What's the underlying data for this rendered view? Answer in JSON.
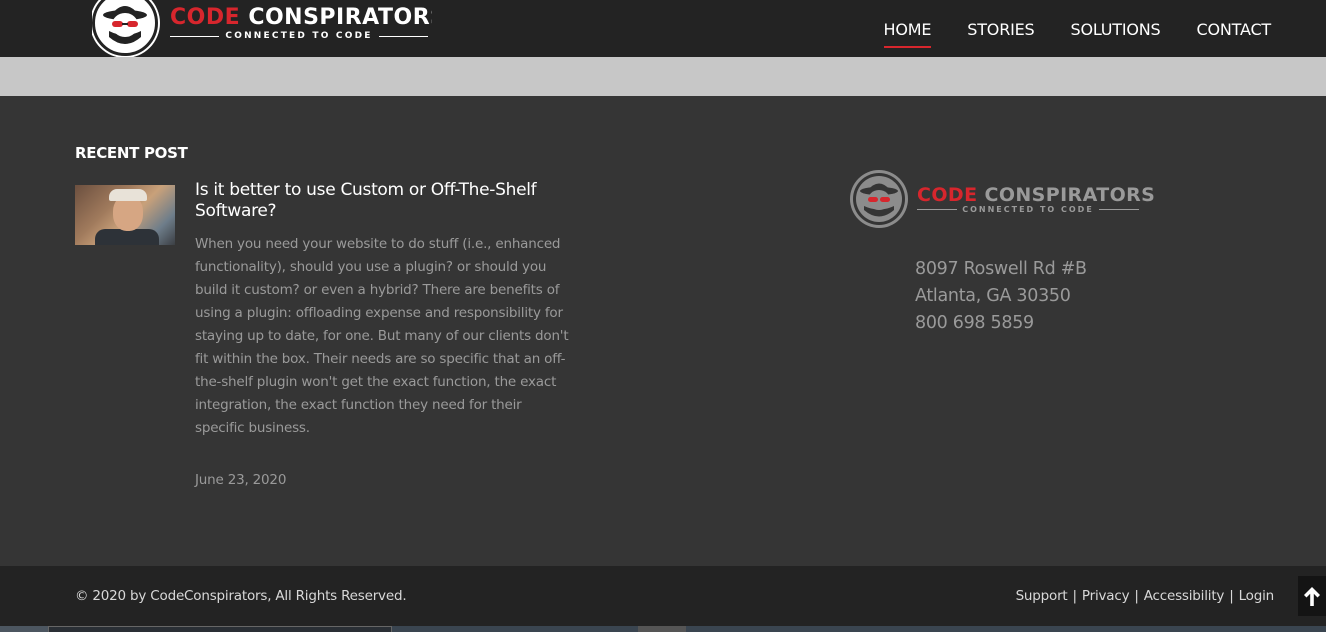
{
  "header": {
    "logo": {
      "word1": "CODE",
      "word2": "CONSPIRATORS",
      "tagline": "CONNECTED TO CODE"
    },
    "nav": [
      {
        "label": "HOME",
        "active": true
      },
      {
        "label": "STORIES",
        "active": false
      },
      {
        "label": "SOLUTIONS",
        "active": false
      },
      {
        "label": "CONTACT",
        "active": false
      }
    ]
  },
  "recent_post": {
    "heading": "RECENT POST",
    "title": "Is it better to use Custom or Off-The-Shelf Software?",
    "excerpt": "When you need your website to do stuff (i.e., enhanced functionality), should you use a plugin? or should you build it custom? or even a hybrid? There are benefits of using a plugin: offloading expense and responsibility for staying up to date, for one. But many of our clients don't fit within the box. Their needs are so specific that an off-the-shelf plugin won't get the exact function, the exact integration, the exact function they need for their specific business.",
    "date": "June 23, 2020"
  },
  "footer_logo": {
    "word1": "CODE",
    "word2": "CONSPIRATORS",
    "tagline": "CONNECTED TO CODE"
  },
  "address": {
    "street": "8097 Roswell Rd #B",
    "city": "Atlanta, GA 30350",
    "phone": "800 698 5859"
  },
  "bottom_bar": {
    "copyright": "© 2020 by CodeConspirators, All Rights Reserved.",
    "links": [
      "Support",
      "Privacy",
      "Accessibility",
      "Login"
    ],
    "separator": "|"
  },
  "colors": {
    "brand_red": "#d7262d",
    "header_bg": "#232323",
    "widget_bg": "#353535"
  },
  "icons": {
    "scroll_top": "arrow-up-icon",
    "logo_badge": "spy-mascot-icon"
  }
}
